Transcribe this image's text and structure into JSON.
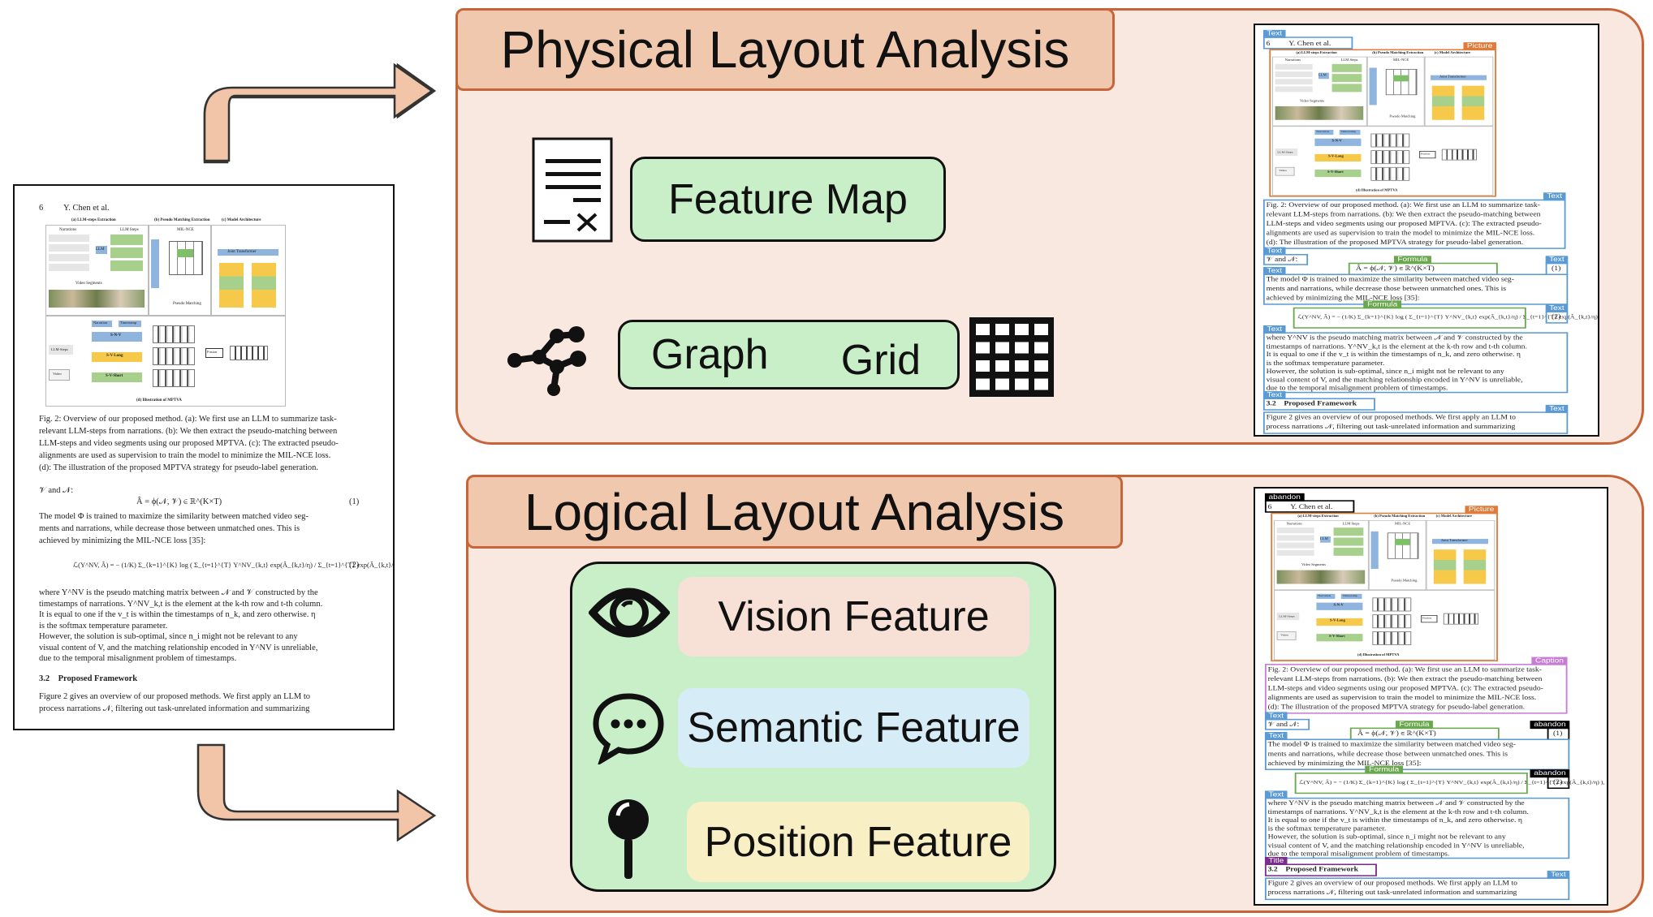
{
  "physical": {
    "title": "Physical Layout Analysis",
    "feature_map": "Feature Map",
    "graph": "Graph",
    "grid": "Grid"
  },
  "logical": {
    "title": "Logical Layout Analysis",
    "vision": "Vision Feature",
    "semantic": "Semantic Feature",
    "position": "Position Feature"
  },
  "colors": {
    "panel_bg": "#f9e8df",
    "panel_border": "#c8643a",
    "title_bg": "#f0c8ae",
    "green": "#c9efc9",
    "vision_bg": "#f7e0d5",
    "semantic_bg": "#d6ecf7",
    "position_bg": "#f8efc5",
    "arrow": "#f2c4a8",
    "big_arrow": "#e9a47e",
    "text_tag": "#5b9bd5",
    "picture_tag": "#e07b39",
    "formula_tag": "#6aa84f",
    "caption_tag": "#c77dd4",
    "title_tag": "#7b2d8e",
    "abandon_tag": "#000000"
  },
  "icons": [
    "document-icon",
    "graph-icon",
    "grid-icon",
    "eye-icon",
    "speech-bubble-icon",
    "pin-icon",
    "arrow-icon"
  ],
  "document": {
    "page_number": "6",
    "running_head": "Y. Chen et al.",
    "figure": {
      "sub_a": "(a) LLM-steps Extraction",
      "sub_b": "(b) Pseudo Matching Extraction",
      "sub_c": "(c) Model Architecture",
      "narrations": "Narrations",
      "llm_steps": "LLM Steps",
      "llm": "LLM",
      "mptva": "MPTVA",
      "milnce": "MIL-NCE",
      "video_segments": "Video Segments",
      "pseudo_matching": "Pseudo Matching",
      "joint_transformer": "Joint Transformer",
      "narration": "Narration",
      "timestamp": "Timestamp",
      "snv": "S-N-V",
      "svlong": "S-V-Long",
      "svshort": "S-V-Short",
      "llm_steps_box": "LLM-Steps",
      "video": "Video",
      "fusion": "Fusion",
      "sub_d": "(d) Illustration of MPTVA"
    },
    "caption_lines": [
      "Fig. 2: Overview of our proposed method. (a): We first use an LLM to summarize task-",
      "relevant LLM-steps from narrations. (b): We then extract the pseudo-matching between",
      "LLM-steps and video segments using our proposed MPTVA. (c): The extracted pseudo-",
      "alignments are used as supervision to train the model to minimize the MIL-NCE loss.",
      "(d): The illustration of the proposed MPTVA strategy for pseudo-label generation."
    ],
    "v_and_n": "𝒱 and 𝒩:",
    "eq1": "Â = ϕ(𝒩, 𝒱) ∈ ℝ^(K×T)",
    "eq1_num": "(1)",
    "para1_lines": [
      "The model Φ is trained to maximize the similarity between matched video seg-",
      "ments and narrations, while decrease those between unmatched ones. This is",
      "achieved by minimizing the MIL-NCE loss [35]:"
    ],
    "eq2": "ℒ(Y^NV, Â) = − (1/K) Σ_{k=1}^{K} log ( Σ_{t=1}^{T} Y^NV_{k,t} exp(Â_{k,t}/η) / Σ_{t=1}^{T} exp(Â_{k,t}/η) ),",
    "eq2_num": "(2)",
    "para2_lines": [
      "where Y^NV is the pseudo matching matrix between 𝒩 and 𝒱 constructed by the",
      "timestamps of narrations. Y^NV_k,t is the element at the k-th row and t-th column.",
      "It is equal to one if the v_t is within the timestamps of n_k, and zero otherwise. η",
      "is the softmax temperature parameter.",
      "    However, the solution is sub-optimal, since n_i might not be relevant to any",
      "visual content of V, and the matching relationship encoded in Y^NV is unreliable,",
      "due to the temporal misalignment problem of timestamps."
    ],
    "section": "3.2    Proposed Framework",
    "para3_lines": [
      "Figure 2 gives an overview of our proposed methods. We first apply an LLM to",
      "process narrations 𝒩, filtering out task-unrelated information and summarizing"
    ]
  },
  "physical_labels": [
    "Text",
    "Picture",
    "Text",
    "Text",
    "Formula",
    "Text",
    "Text",
    "Formula",
    "Text",
    "Text",
    "Text",
    "Text"
  ],
  "logical_labels": [
    "abandon",
    "Picture",
    "Caption",
    "Text",
    "Formula",
    "abandon",
    "Text",
    "Formula",
    "abandon",
    "Text",
    "Title",
    "Text"
  ]
}
